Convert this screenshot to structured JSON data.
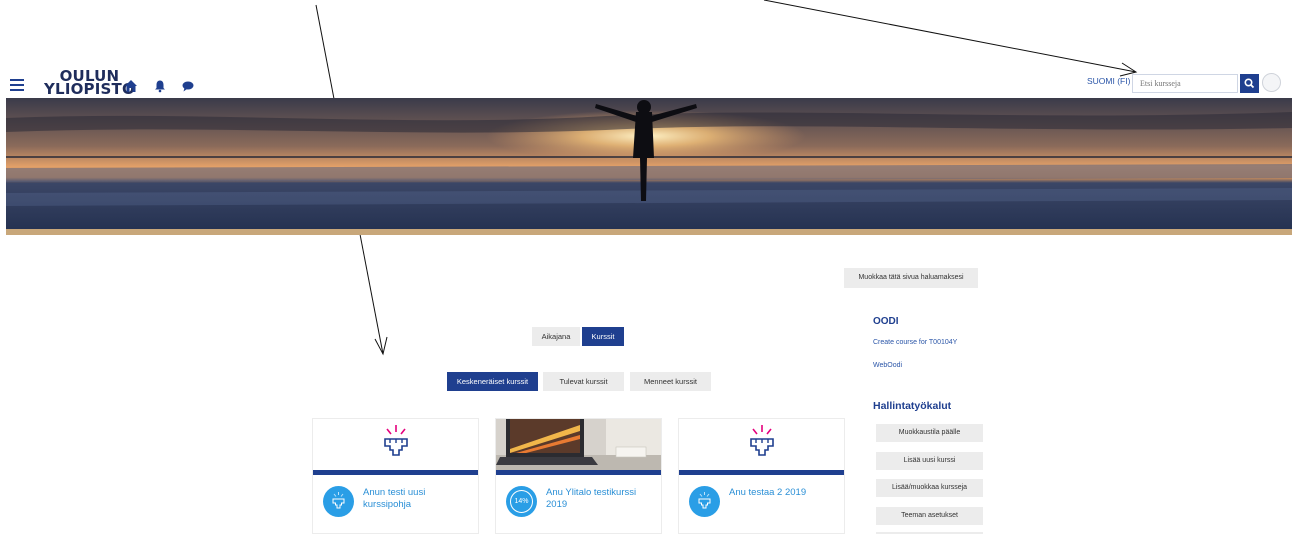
{
  "header": {
    "logo_line1": "OULUN",
    "logo_line2": "YLIOPISTO",
    "language": "SUOMI (FI)",
    "search_placeholder": "Etsi kursseja"
  },
  "main": {
    "edit_page_button": "Muokkaa tätä sivua haluamaksesi",
    "view_tabs": [
      "Aikajana",
      "Kurssit"
    ],
    "filter_tabs": [
      "Keskeneräiset kurssit",
      "Tulevat kurssit",
      "Menneet kurssit"
    ],
    "courses": [
      {
        "title": "Anun testi uusi kurssipohja",
        "progress": ""
      },
      {
        "title": "Anu Ylitalo testikurssi 2019",
        "progress": "14%"
      },
      {
        "title": "Anu testaa 2 2019",
        "progress": ""
      }
    ]
  },
  "sidebar": {
    "oodi_title": "OODI",
    "oodi_links": [
      "Create course for T00104Y",
      "WebOodi"
    ],
    "tools_title": "Hallintatyökalut",
    "tools_buttons": [
      "Muokkaustila päälle",
      "Lisää uusi kurssi",
      "Lisää/muokkaa kursseja",
      "Teeman asetukset"
    ]
  },
  "colors": {
    "brand": "#1f3f8f",
    "accent": "#2a9ee6",
    "banner_base": "#c8a77a"
  }
}
